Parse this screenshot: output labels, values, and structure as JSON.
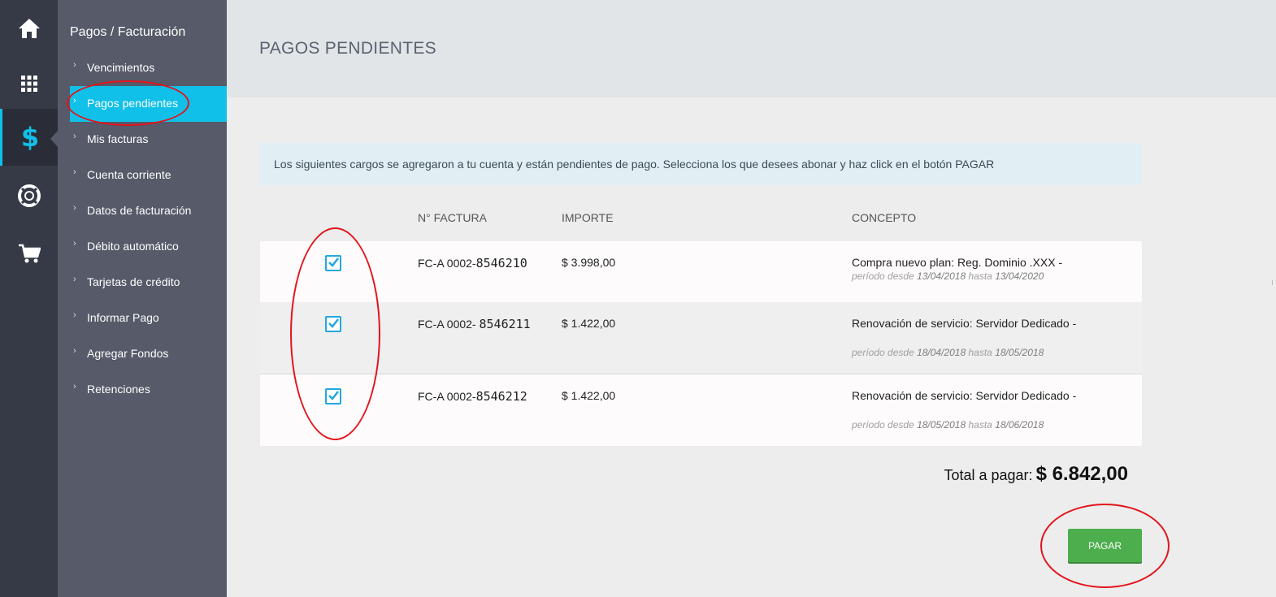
{
  "rail": {
    "items": [
      {
        "icon": "home-icon"
      },
      {
        "icon": "apps-grid-icon"
      },
      {
        "icon": "dollar-icon",
        "active": true
      },
      {
        "icon": "lifebuoy-icon"
      },
      {
        "icon": "cart-icon"
      }
    ],
    "active_color": "#11c0e8"
  },
  "subnav": {
    "title": "Pagos / Facturación",
    "items": [
      {
        "label": "Vencimientos"
      },
      {
        "label": "Pagos pendientes",
        "active": true
      },
      {
        "label": "Mis facturas"
      },
      {
        "label": "Cuenta corriente"
      },
      {
        "label": "Datos de facturación"
      },
      {
        "label": "Débito automático"
      },
      {
        "label": "Tarjetas de crédito"
      },
      {
        "label": "Informar Pago"
      },
      {
        "label": "Agregar Fondos"
      },
      {
        "label": "Retenciones"
      }
    ]
  },
  "page": {
    "title": "PAGOS PENDIENTES",
    "notice": "Los siguientes cargos se agregaron a tu cuenta y están pendientes de pago. Selecciona los que desees abonar y haz click en el botón PAGAR"
  },
  "table": {
    "headers": {
      "invoice": "N° FACTURA",
      "amount": "IMPORTE",
      "concept": "CONCEPTO"
    },
    "period_labels": {
      "from": "período desde",
      "to": "hasta"
    },
    "rows": [
      {
        "checked": true,
        "invoice_prefix": "FC-A 0002-",
        "invoice_number": "8546210",
        "amount": "$ 3.998,00",
        "concept": "Compra nuevo plan: Reg. Dominio .XXX -",
        "from": "13/04/2018",
        "to": "13/04/2020"
      },
      {
        "checked": true,
        "invoice_prefix": "FC-A 0002- ",
        "invoice_number": "8546211",
        "amount": "$ 1.422,00",
        "concept": "Renovación de servicio: Servidor Dedicado -",
        "from": "18/04/2018",
        "to": "18/05/2018"
      },
      {
        "checked": true,
        "invoice_prefix": "FC-A 0002-",
        "invoice_number": "8546212",
        "amount": "$ 1.422,00",
        "concept": "Renovación de servicio: Servidor Dedicado -",
        "from": "18/05/2018",
        "to": "18/06/2018"
      }
    ]
  },
  "summary": {
    "total_label": "Total a pagar:",
    "total_value": "$ 6.842,00",
    "pay_button": "PAGAR"
  },
  "colors": {
    "accent": "#11c0e8",
    "pay_button": "#4cae4c",
    "annotation": "#e3141b"
  }
}
